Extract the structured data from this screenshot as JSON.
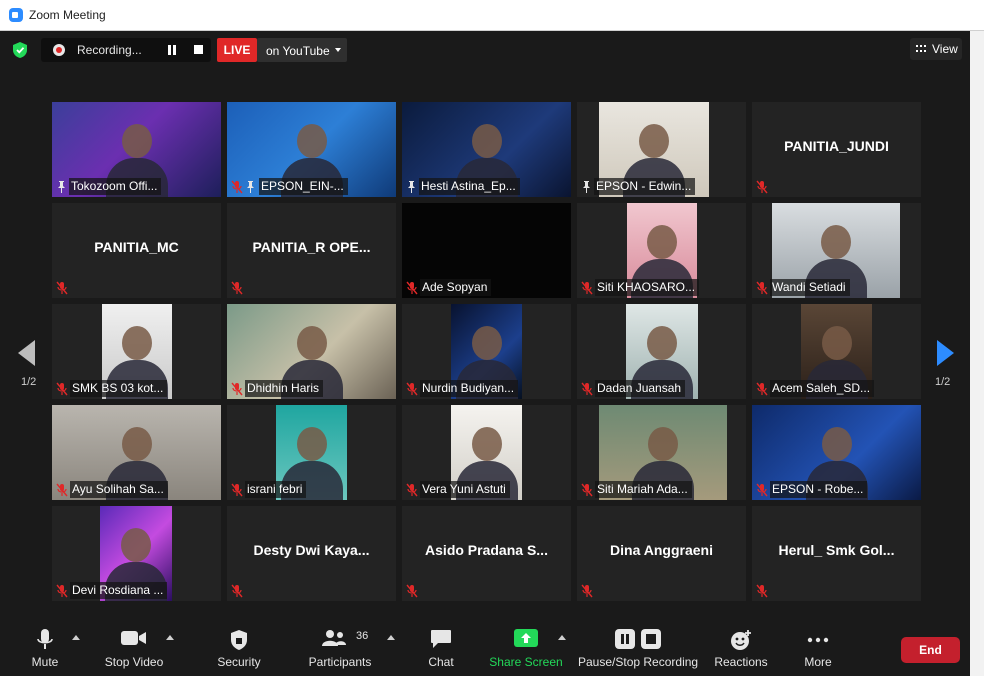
{
  "window": {
    "title": "Zoom Meeting"
  },
  "top_bar": {
    "recording_label": "Recording...",
    "live_label": "LIVE",
    "stream_label": "on YouTube",
    "view_label": "View"
  },
  "pagination": {
    "left": "1/2",
    "right": "1/2"
  },
  "tiles": [
    {
      "name": "Tokozoom Offi...",
      "video": true,
      "active": true,
      "pinned": true,
      "muted": false,
      "scene": "studio"
    },
    {
      "name": "EPSON_EIN-...",
      "video": true,
      "pinned": true,
      "muted": true,
      "scene": "blue"
    },
    {
      "name": "Hesti Astina_Ep...",
      "video": true,
      "pinned": true,
      "muted": false,
      "scene": "epson_dark"
    },
    {
      "name": "EPSON - Edwin...",
      "video": true,
      "pinned": true,
      "muted": false,
      "scene": "room"
    },
    {
      "name": "PANITIA_JUNDI",
      "video": false,
      "muted": true
    },
    {
      "name": "PANITIA_MC",
      "video": false,
      "muted": true
    },
    {
      "name": "PANITIA_R OPE...",
      "video": false,
      "muted": true
    },
    {
      "name": "Ade Sopyan",
      "video": true,
      "muted": true,
      "scene": "black"
    },
    {
      "name": "Siti KHAOSARO...",
      "video": true,
      "muted": true,
      "scene": "pink"
    },
    {
      "name": "Wandi Setiadi",
      "video": true,
      "muted": true,
      "scene": "office"
    },
    {
      "name": "SMK BS 03 kot...",
      "video": true,
      "muted": true,
      "scene": "white"
    },
    {
      "name": "Dhidhin Haris",
      "video": true,
      "muted": true,
      "scene": "room_green"
    },
    {
      "name": "Nurdin Budiyan...",
      "video": true,
      "muted": true,
      "scene": "space"
    },
    {
      "name": "Dadan Juansah",
      "video": true,
      "muted": true,
      "scene": "lightroom"
    },
    {
      "name": "Acem Saleh_SD...",
      "video": true,
      "muted": true,
      "scene": "dark_room"
    },
    {
      "name": "Ayu Solihah Sa...",
      "video": true,
      "muted": true,
      "scene": "grey"
    },
    {
      "name": "israni febri",
      "video": true,
      "muted": true,
      "scene": "teal"
    },
    {
      "name": "Vera Yuni Astuti",
      "video": true,
      "muted": true,
      "scene": "white2"
    },
    {
      "name": "Siti Mariah Ada...",
      "video": true,
      "muted": true,
      "scene": "green_wall"
    },
    {
      "name": "EPSON - Robe...",
      "video": true,
      "muted": true,
      "scene": "epson_blue"
    },
    {
      "name": "Devi Rosdiana ...",
      "video": true,
      "muted": true,
      "scene": "purple"
    },
    {
      "name": "Desty Dwi Kaya...",
      "video": false,
      "muted": true
    },
    {
      "name": "Asido Pradana S...",
      "video": false,
      "muted": true
    },
    {
      "name": "Dina Anggraeni",
      "video": false,
      "muted": true
    },
    {
      "name": "Herul_ Smk Gol...",
      "video": false,
      "muted": true
    }
  ],
  "toolbar": {
    "mute": "Mute",
    "stop_video": "Stop Video",
    "security": "Security",
    "participants": "Participants",
    "participants_count": "36",
    "chat": "Chat",
    "share_screen": "Share Screen",
    "pause_stop_recording": "Pause/Stop Recording",
    "reactions": "Reactions",
    "more": "More",
    "end": "End"
  },
  "colors": {
    "accent": "#2D8CFF",
    "live": "#E02828",
    "end": "#C4202D",
    "share": "#23D959",
    "active_border": "#F2E31A"
  }
}
